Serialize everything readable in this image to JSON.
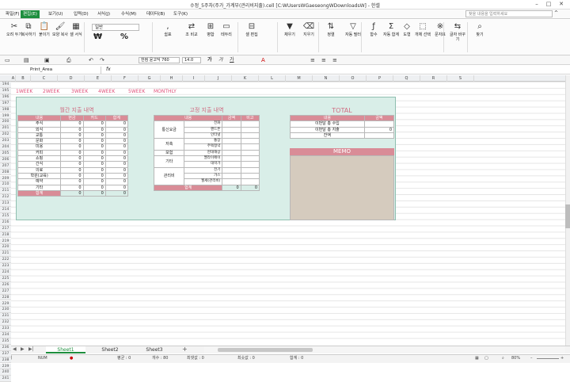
{
  "window": {
    "title": "수정_5주차(주가_가계부(관리비지출).cell [C:WUsersWGaeseongWDownloadsW] - 한셀"
  },
  "menu": [
    {
      "label": "파일(F)"
    },
    {
      "label": "편집(E)",
      "active": true
    },
    {
      "label": "보기(U)"
    },
    {
      "label": "입력(D)"
    },
    {
      "label": "서식(J)"
    },
    {
      "label": "수식(M)"
    },
    {
      "label": "데이터(B)"
    },
    {
      "label": "도구(K)"
    }
  ],
  "help_placeholder": "찾을 내용을 입력하세요",
  "ribbon": {
    "buttons": [
      {
        "label": "오려 두기",
        "icon": "scissors-icon"
      },
      {
        "label": "복사하기",
        "icon": "copy-icon"
      },
      {
        "label": "붙이기",
        "icon": "paste-icon"
      },
      {
        "label": "모양 복사",
        "icon": "format-painter-icon"
      },
      {
        "label": "셀 서식",
        "icon": "cell-format-icon"
      },
      {
        "label": "쉼표",
        "icon": "comma-icon"
      },
      {
        "label": "조 비교",
        "icon": "compare-icon"
      },
      {
        "label": "병합",
        "icon": "merge-icon"
      },
      {
        "label": "테두리",
        "icon": "border-icon"
      },
      {
        "label": "셀 편집",
        "icon": "cell-edit-icon"
      },
      {
        "label": "채우기",
        "icon": "fill-icon"
      },
      {
        "label": "지우기",
        "icon": "eraser-icon"
      },
      {
        "label": "정렬",
        "icon": "sort-icon"
      },
      {
        "label": "자동 필터",
        "icon": "filter-icon"
      },
      {
        "label": "함수",
        "icon": "function-icon"
      },
      {
        "label": "자동 합계",
        "icon": "sum-icon"
      },
      {
        "label": "도형",
        "icon": "shape-icon"
      },
      {
        "label": "개체 선택",
        "icon": "select-icon"
      },
      {
        "label": "문자표",
        "icon": "symbol-icon"
      },
      {
        "label": "글자 바꾸기",
        "icon": "replace-icon"
      },
      {
        "label": "찾기",
        "icon": "find-icon"
      }
    ],
    "number_format": "일반",
    "pct_label": "%",
    "won_label": "₩"
  },
  "toolbar": {
    "font": "한컴 윤고딕 760",
    "size": "14.0",
    "bold": "가",
    "italic": "가",
    "underline": "가"
  },
  "formula": {
    "name": "Print_Area",
    "fx": "fx"
  },
  "columns": [
    "A",
    "B",
    "C",
    "D",
    "E",
    "F",
    "G",
    "H",
    "I",
    "J",
    "K",
    "L",
    "M",
    "N",
    "O",
    "P",
    "Q",
    "R",
    "S"
  ],
  "rows": [
    "194",
    "195",
    "196",
    "197",
    "198",
    "199",
    "200",
    "201",
    "202",
    "203",
    "204",
    "205",
    "206",
    "207",
    "208",
    "209",
    "210",
    "211",
    "212",
    "213",
    "214",
    "215",
    "216",
    "217",
    "218",
    "219",
    "220",
    "221",
    "222",
    "223",
    "224",
    "225",
    "226",
    "227",
    "228",
    "229",
    "230",
    "231",
    "232",
    "233",
    "234",
    "235",
    "236",
    "237",
    "238",
    "239",
    "240",
    "241"
  ],
  "weeks": [
    "1WEEK",
    "2WEEK",
    "3WEEK",
    "4WEEK",
    "5WEEK",
    "MONTHLY"
  ],
  "monthly": {
    "title": "월간 지출 내역",
    "headers": [
      "내용",
      "현금",
      "카드",
      "합계"
    ],
    "rows": [
      [
        "주식",
        "0",
        "0",
        "0"
      ],
      [
        "외식",
        "0",
        "0",
        "0"
      ],
      [
        "교통",
        "0",
        "0",
        "0"
      ],
      [
        "문화",
        "0",
        "0",
        "0"
      ],
      [
        "미용",
        "0",
        "0",
        "0"
      ],
      [
        "커피",
        "0",
        "0",
        "0"
      ],
      [
        "쇼핑",
        "0",
        "0",
        "0"
      ],
      [
        "간식",
        "0",
        "0",
        "0"
      ],
      [
        "의료",
        "0",
        "0",
        "0"
      ],
      [
        "학원(교육)",
        "0",
        "0",
        "0"
      ],
      [
        "예약",
        "0",
        "0",
        "0"
      ],
      [
        "기타",
        "0",
        "0",
        "0"
      ]
    ],
    "total": [
      "합계",
      "0",
      "0",
      "0"
    ]
  },
  "fixed": {
    "title": "고정 지출 내역",
    "headers": [
      "내용",
      "",
      "금액",
      "비고"
    ],
    "groups": [
      {
        "name": "통신요금",
        "items": [
          "전화",
          "핸드폰",
          "인터넷"
        ]
      },
      {
        "name": "저축",
        "items": [
          "통장",
          "주택청약"
        ]
      },
      {
        "name": "보험",
        "items": [
          "현대해상"
        ]
      },
      {
        "name": "기타",
        "items": [
          "멜라이메이",
          "대학가"
        ]
      },
      {
        "name": "관리비",
        "items": [
          "전기",
          "가스",
          "월세(관리비)"
        ]
      }
    ],
    "total": [
      "합계",
      "0",
      "0"
    ]
  },
  "total_box": {
    "title": "TOTAL",
    "headers": [
      "내용",
      "금액"
    ],
    "rows": [
      [
        "이번달 총 수입",
        ""
      ],
      [
        "이번달 총 지출",
        "0"
      ],
      [
        "잔액",
        ""
      ]
    ]
  },
  "memo_title": "MEMO",
  "sheets": [
    {
      "name": "Sheet1",
      "active": true
    },
    {
      "name": "Sheet2"
    },
    {
      "name": "Sheet3"
    }
  ],
  "status": {
    "mode": "준비",
    "num": "NUM",
    "avg": "평균 : 0",
    "count": "개수 : 80",
    "max": "최댓값 : 0",
    "min": "최솟값 : 0",
    "sum": "합계 : 0",
    "zoom": "80%"
  }
}
